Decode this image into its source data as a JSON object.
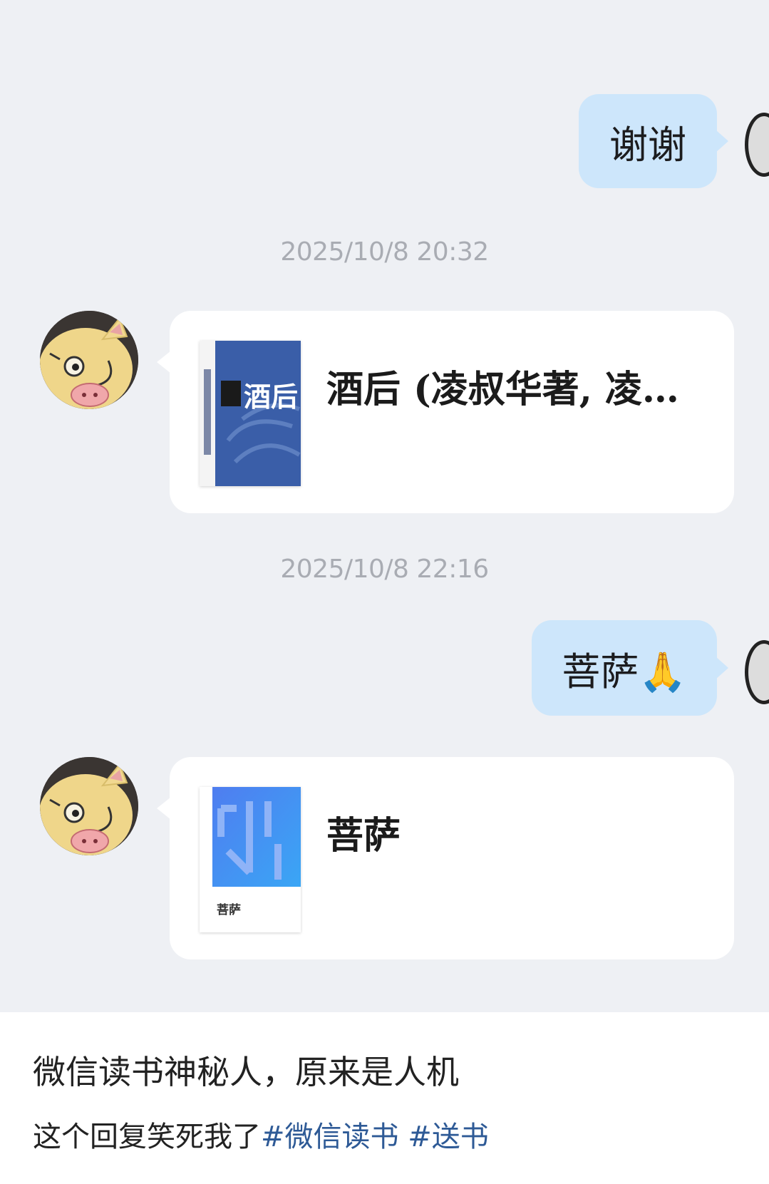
{
  "messages": {
    "out1": {
      "text": "谢谢"
    },
    "ts1": "2025/10/8 20:32",
    "card1": {
      "title": "酒后 (凌叔华著, 凌…",
      "cover_text": "酒后"
    },
    "ts2": "2025/10/8 22:16",
    "out2": {
      "text": "菩萨🙏"
    },
    "card2": {
      "title": "菩萨",
      "cover_label": "菩萨"
    }
  },
  "post": {
    "caption": "微信读书神秘人，原来是人机",
    "subline": "这个回复笑死我了",
    "hashtags": [
      "#微信读书",
      "#送书"
    ]
  },
  "colors": {
    "chat_bg": "#eef0f4",
    "outgoing_bubble": "#cde6fb",
    "hashtag": "#2e5a96"
  }
}
